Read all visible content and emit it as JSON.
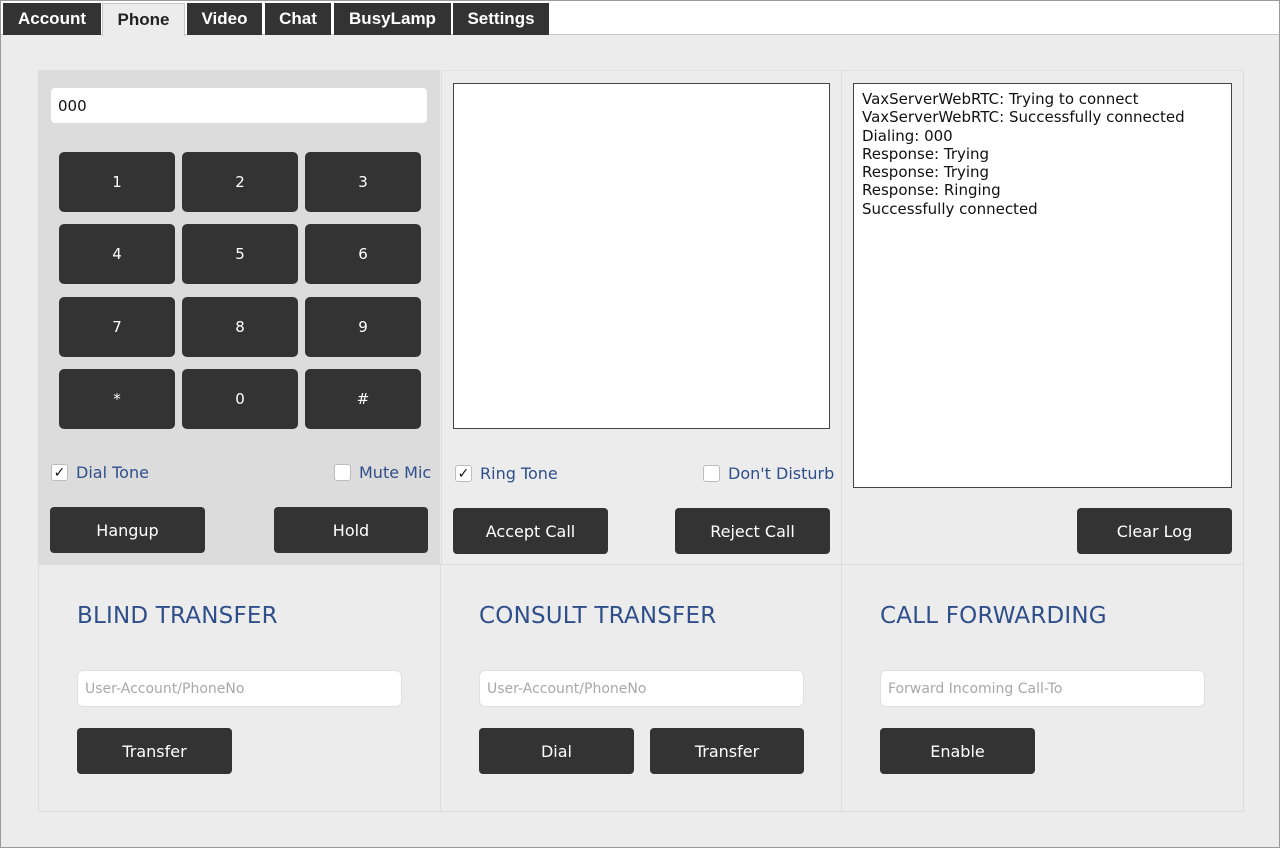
{
  "tabs": [
    {
      "label": "Account",
      "active": false
    },
    {
      "label": "Phone",
      "active": true
    },
    {
      "label": "Video",
      "active": false
    },
    {
      "label": "Chat",
      "active": false
    },
    {
      "label": "BusyLamp",
      "active": false
    },
    {
      "label": "Settings",
      "active": false
    }
  ],
  "dialer": {
    "number_value": "000",
    "keys": [
      "1",
      "2",
      "3",
      "4",
      "5",
      "6",
      "7",
      "8",
      "9",
      "*",
      "0",
      "#"
    ],
    "dial_tone": {
      "label": "Dial Tone",
      "checked": true
    },
    "mute_mic": {
      "label": "Mute Mic",
      "checked": false
    },
    "hangup_label": "Hangup",
    "hold_label": "Hold"
  },
  "video": {
    "ring_tone": {
      "label": "Ring Tone",
      "checked": true
    },
    "dont_disturb": {
      "label": "Don't Disturb",
      "checked": false
    },
    "accept_label": "Accept Call",
    "reject_label": "Reject Call"
  },
  "log": {
    "lines": [
      "VaxServerWebRTC: Trying to connect",
      "VaxServerWebRTC: Successfully connected",
      "Dialing: 000",
      "Response: Trying",
      "Response: Trying",
      "Response: Ringing",
      "Successfully connected"
    ],
    "clear_label": "Clear Log"
  },
  "blind_transfer": {
    "heading": "BLIND TRANSFER",
    "placeholder": "User-Account/PhoneNo",
    "transfer_label": "Transfer"
  },
  "consult_transfer": {
    "heading": "CONSULT TRANSFER",
    "placeholder": "User-Account/PhoneNo",
    "dial_label": "Dial",
    "transfer_label": "Transfer"
  },
  "call_forwarding": {
    "heading": "CALL FORWARDING",
    "placeholder": "Forward Incoming Call-To",
    "enable_label": "Enable"
  },
  "colors": {
    "button": "#333333",
    "accent_text": "#2f4f8a",
    "background": "#ececec",
    "dialer_panel": "#dcdcdc"
  },
  "icons": {
    "checkmark": "check-icon"
  }
}
